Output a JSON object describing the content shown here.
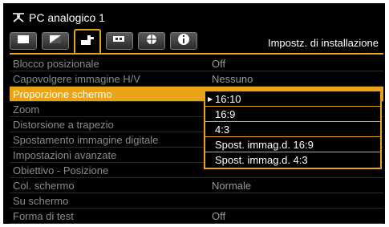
{
  "window": {
    "title": "PC analogico 1",
    "input_icon": "input-terminal-icon"
  },
  "tabs": [
    {
      "icon": "image-adjust-icon"
    },
    {
      "icon": "image-quality-icon"
    },
    {
      "icon": "installation-icon",
      "active": true
    },
    {
      "icon": "system-settings-icon"
    },
    {
      "icon": "network-icon"
    },
    {
      "icon": "info-icon"
    }
  ],
  "active_tab_title": "Impostz. di installazione",
  "menu": {
    "items": [
      {
        "label": "Blocco posizionale",
        "value": "Off"
      },
      {
        "label": "Capovolgere immagine H/V",
        "value": "Nessuno"
      },
      {
        "label": "Proporzione schermo",
        "value": ""
      },
      {
        "label": "Zoom",
        "value": ""
      },
      {
        "label": "Distorsione a trapezio",
        "value": ""
      },
      {
        "label": "Spostamento immagine digitale",
        "value": ""
      },
      {
        "label": "Impostazioni avanzate",
        "value": ""
      },
      {
        "label": "Obiettivo - Posizione",
        "value": ""
      },
      {
        "label": "Col. schermo",
        "value": "Normale"
      },
      {
        "label": "Su schermo",
        "value": ""
      },
      {
        "label": "Forma di test",
        "value": "Off"
      }
    ],
    "selected_index": 2
  },
  "dropdown": {
    "options": [
      "16:10",
      "16:9",
      "4:3",
      "Spost. immag.d. 16:9",
      "Spost. immag.d. 4:3"
    ],
    "current": "16:10"
  },
  "colors": {
    "accent": "#e8a317",
    "background": "#000000",
    "text_dim": "#8a8a8a"
  }
}
